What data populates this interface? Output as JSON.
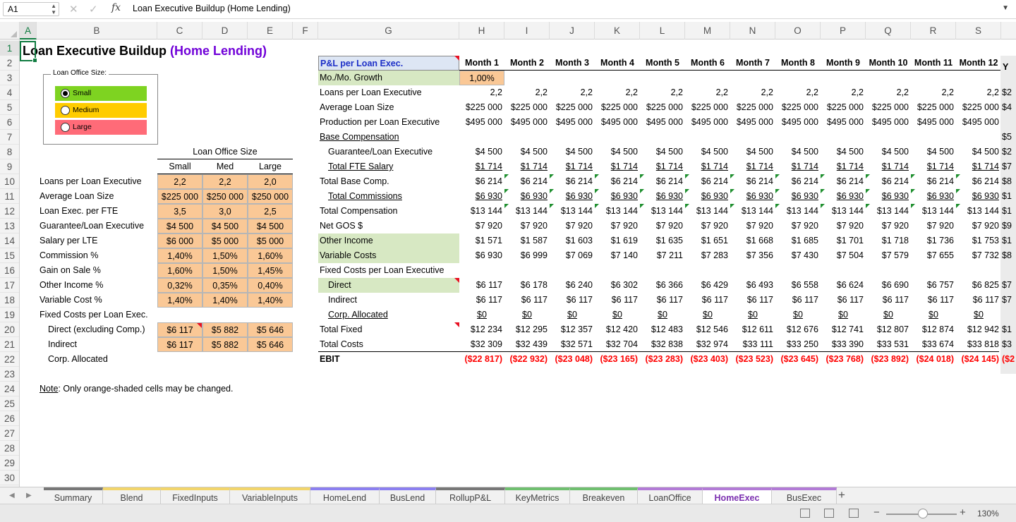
{
  "formula_bar": {
    "cell_ref": "A1",
    "value": "Loan Executive Buildup (Home Lending)"
  },
  "columns": [
    "A",
    "B",
    "C",
    "D",
    "E",
    "F",
    "G",
    "H",
    "I",
    "J",
    "K",
    "L",
    "M",
    "N",
    "O",
    "P",
    "Q",
    "R",
    "S"
  ],
  "rows": [
    "1",
    "2",
    "3",
    "4",
    "5",
    "6",
    "7",
    "8",
    "9",
    "10",
    "11",
    "12",
    "13",
    "14",
    "15",
    "16",
    "17",
    "18",
    "19",
    "20",
    "21",
    "22",
    "23",
    "24",
    "25",
    "26",
    "27",
    "28",
    "29",
    "30"
  ],
  "title": {
    "main": "Loan Executive Buildup",
    "highlight": "(Home Lending)"
  },
  "office_size": {
    "group_label": "Loan Office Size:",
    "options": [
      {
        "label": "Small",
        "color": "#7ed321",
        "selected": true
      },
      {
        "label": "Medium",
        "color": "#ffcc00",
        "selected": false
      },
      {
        "label": "Large",
        "color": "#ff6b78",
        "selected": false
      }
    ]
  },
  "inputs": {
    "header": "Loan Office Size",
    "sizes": [
      "Small",
      "Med",
      "Large"
    ],
    "rows": [
      {
        "label": "Loans per Loan Executive",
        "values": [
          "2,2",
          "2,2",
          "2,0"
        ]
      },
      {
        "label": "Average Loan Size",
        "values": [
          "$225 000",
          "$250 000",
          "$250 000"
        ]
      },
      {
        "label": "Loan Exec. per FTE",
        "values": [
          "3,5",
          "3,0",
          "2,5"
        ]
      },
      {
        "label": "Guarantee/Loan Executive",
        "values": [
          "$4 500",
          "$4 500",
          "$4 500"
        ]
      },
      {
        "label": "Salary per LTE",
        "values": [
          "$6 000",
          "$5 000",
          "$5 000"
        ]
      },
      {
        "label": "Commission %",
        "values": [
          "1,40%",
          "1,50%",
          "1,60%"
        ]
      },
      {
        "label": "Gain on Sale %",
        "values": [
          "1,60%",
          "1,50%",
          "1,45%"
        ]
      },
      {
        "label": "Other Income %",
        "values": [
          "0,32%",
          "0,35%",
          "0,40%"
        ]
      },
      {
        "label": "Variable Cost %",
        "values": [
          "1,40%",
          "1,40%",
          "1,40%"
        ]
      },
      {
        "label": "Fixed Costs per Loan Exec.",
        "values": []
      },
      {
        "label": "Direct (excluding Comp.)",
        "values": [
          "$6 117",
          "$5 882",
          "$5 646"
        ]
      },
      {
        "label": "Indirect",
        "values": [
          "$6 117",
          "$5 882",
          "$5 646"
        ]
      },
      {
        "label": "Corp. Allocated",
        "values": []
      }
    ],
    "note_label": "Note",
    "note_text": ": Only orange-shaded cells may be changed."
  },
  "pl": {
    "header": "P&L per Loan Exec.",
    "months": [
      "Month 1",
      "Month 2",
      "Month 3",
      "Month 4",
      "Month 5",
      "Month 6",
      "Month 7",
      "Month 8",
      "Month 9",
      "Month 10",
      "Month 11",
      "Month 12"
    ],
    "truncated_header": "Y",
    "growth_label": "Mo./Mo. Growth",
    "growth_value": "1,00%",
    "rows": [
      {
        "label": "Loans per Loan Executive",
        "values": [
          "2,2",
          "2,2",
          "2,2",
          "2,2",
          "2,2",
          "2,2",
          "2,2",
          "2,2",
          "2,2",
          "2,2",
          "2,2",
          "2,2"
        ]
      },
      {
        "label": "Average Loan Size",
        "values": [
          "$225 000",
          "$225 000",
          "$225 000",
          "$225 000",
          "$225 000",
          "$225 000",
          "$225 000",
          "$225 000",
          "$225 000",
          "$225 000",
          "$225 000",
          "$225 000"
        ]
      },
      {
        "label": "Production per Loan Executive",
        "values": [
          "$495 000",
          "$495 000",
          "$495 000",
          "$495 000",
          "$495 000",
          "$495 000",
          "$495 000",
          "$495 000",
          "$495 000",
          "$495 000",
          "$495 000",
          "$495 000"
        ]
      },
      {
        "label": "Base Compensation",
        "values": []
      },
      {
        "label": "Guarantee/Loan Executive",
        "values": [
          "$4 500",
          "$4 500",
          "$4 500",
          "$4 500",
          "$4 500",
          "$4 500",
          "$4 500",
          "$4 500",
          "$4 500",
          "$4 500",
          "$4 500",
          "$4 500"
        ]
      },
      {
        "label": "Total FTE Salary",
        "values": [
          "$1 714",
          "$1 714",
          "$1 714",
          "$1 714",
          "$1 714",
          "$1 714",
          "$1 714",
          "$1 714",
          "$1 714",
          "$1 714",
          "$1 714",
          "$1 714"
        ]
      },
      {
        "label": "Total Base Comp.",
        "values": [
          "$6 214",
          "$6 214",
          "$6 214",
          "$6 214",
          "$6 214",
          "$6 214",
          "$6 214",
          "$6 214",
          "$6 214",
          "$6 214",
          "$6 214",
          "$6 214"
        ]
      },
      {
        "label": "Total Commissions",
        "values": [
          "$6 930",
          "$6 930",
          "$6 930",
          "$6 930",
          "$6 930",
          "$6 930",
          "$6 930",
          "$6 930",
          "$6 930",
          "$6 930",
          "$6 930",
          "$6 930"
        ]
      },
      {
        "label": "Total Compensation",
        "values": [
          "$13 144",
          "$13 144",
          "$13 144",
          "$13 144",
          "$13 144",
          "$13 144",
          "$13 144",
          "$13 144",
          "$13 144",
          "$13 144",
          "$13 144",
          "$13 144"
        ]
      },
      {
        "label": "Net GOS $",
        "values": [
          "$7 920",
          "$7 920",
          "$7 920",
          "$7 920",
          "$7 920",
          "$7 920",
          "$7 920",
          "$7 920",
          "$7 920",
          "$7 920",
          "$7 920",
          "$7 920"
        ]
      },
      {
        "label": "Other Income",
        "values": [
          "$1 571",
          "$1 587",
          "$1 603",
          "$1 619",
          "$1 635",
          "$1 651",
          "$1 668",
          "$1 685",
          "$1 701",
          "$1 718",
          "$1 736",
          "$1 753"
        ]
      },
      {
        "label": "Variable Costs",
        "values": [
          "$6 930",
          "$6 999",
          "$7 069",
          "$7 140",
          "$7 211",
          "$7 283",
          "$7 356",
          "$7 430",
          "$7 504",
          "$7 579",
          "$7 655",
          "$7 732"
        ]
      },
      {
        "label": "Fixed Costs per Loan Executive",
        "values": []
      },
      {
        "label": "Direct",
        "values": [
          "$6 117",
          "$6 178",
          "$6 240",
          "$6 302",
          "$6 366",
          "$6 429",
          "$6 493",
          "$6 558",
          "$6 624",
          "$6 690",
          "$6 757",
          "$6 825"
        ]
      },
      {
        "label": "Indirect",
        "values": [
          "$6 117",
          "$6 117",
          "$6 117",
          "$6 117",
          "$6 117",
          "$6 117",
          "$6 117",
          "$6 117",
          "$6 117",
          "$6 117",
          "$6 117",
          "$6 117"
        ]
      },
      {
        "label": "Corp. Allocated",
        "values": [
          "$0",
          "$0",
          "$0",
          "$0",
          "$0",
          "$0",
          "$0",
          "$0",
          "$0",
          "$0",
          "$0",
          "$0"
        ]
      },
      {
        "label": "Total Fixed",
        "values": [
          "$12 234",
          "$12 295",
          "$12 357",
          "$12 420",
          "$12 483",
          "$12 546",
          "$12 611",
          "$12 676",
          "$12 741",
          "$12 807",
          "$12 874",
          "$12 942"
        ]
      },
      {
        "label": "Total Costs",
        "values": [
          "$32 309",
          "$32 439",
          "$32 571",
          "$32 704",
          "$32 838",
          "$32 974",
          "$33 111",
          "$33 250",
          "$33 390",
          "$33 531",
          "$33 674",
          "$33 818"
        ]
      },
      {
        "label": "EBIT",
        "values": [
          "($22 817)",
          "($22 932)",
          "($23 048)",
          "($23 165)",
          "($23 283)",
          "($23 403)",
          "($23 523)",
          "($23 645)",
          "($23 768)",
          "($23 892)",
          "($24 018)",
          "($24 145)"
        ]
      }
    ],
    "truncated_col": [
      "",
      "",
      "$2",
      "$4",
      "",
      "$5",
      "$2",
      "$7",
      "$8",
      "$1",
      "$1",
      "$9",
      "$1",
      "$8",
      "",
      "$7",
      "$7",
      "",
      "$1",
      "$3",
      "($2"
    ]
  },
  "tabs": [
    {
      "label": "Summary",
      "color": "#777777"
    },
    {
      "label": "Blend",
      "color": "#f2d56b"
    },
    {
      "label": "FixedInputs",
      "color": "#f2d56b"
    },
    {
      "label": "VariableInputs",
      "color": "#f2d56b"
    },
    {
      "label": "HomeLend",
      "color": "#8b7ff0"
    },
    {
      "label": "BusLend",
      "color": "#8b7ff0"
    },
    {
      "label": "RollupP&L",
      "color": "#777777"
    },
    {
      "label": "KeyMetrics",
      "color": "#6fbf6f"
    },
    {
      "label": "Breakeven",
      "color": "#6fbf6f"
    },
    {
      "label": "LoanOffice",
      "color": "#b27ad6"
    },
    {
      "label": "HomeExec",
      "color": "#b27ad6",
      "active": true
    },
    {
      "label": "BusExec",
      "color": "#b27ad6"
    }
  ],
  "status": {
    "zoom": "130%"
  }
}
